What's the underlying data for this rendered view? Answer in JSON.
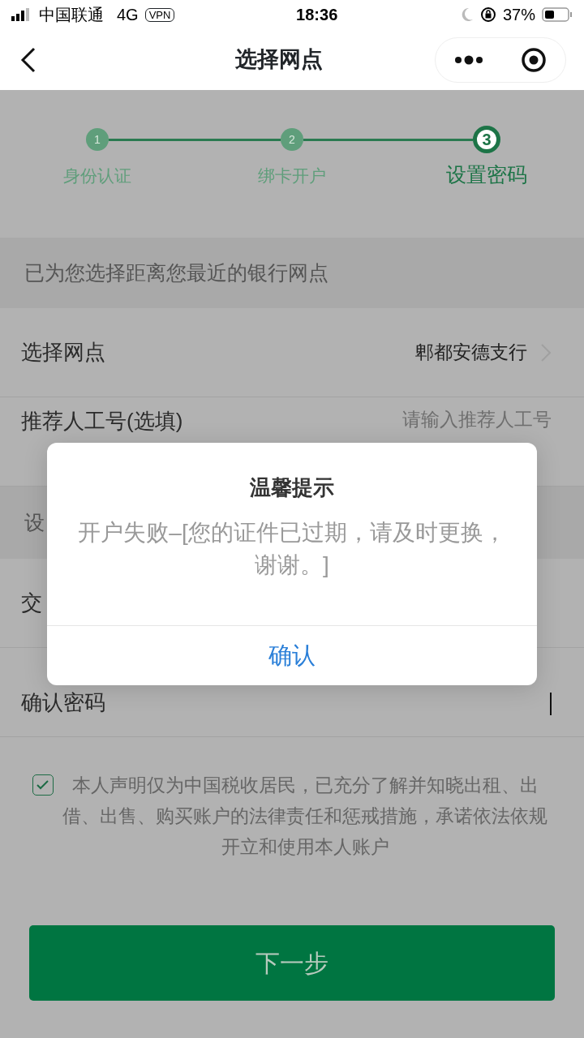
{
  "status_bar": {
    "carrier": "中国联通",
    "network": "4G",
    "vpn": "VPN",
    "time": "18:36",
    "battery": "37%"
  },
  "nav": {
    "title": "选择网点"
  },
  "steps": [
    {
      "number": "1",
      "label": "身份认证",
      "selected": false
    },
    {
      "number": "2",
      "label": "绑卡开户",
      "selected": false
    },
    {
      "number": "3",
      "label": "设置密码",
      "selected": true
    }
  ],
  "form": [
    {
      "kind": "notice",
      "label": "已为您选择距离您最近的银行网点"
    },
    {
      "kind": "select",
      "label": "选择网点",
      "value": "郫都安德支行"
    },
    {
      "kind": "input",
      "label": "推荐人工号(选填)",
      "placeholder": "请输入推荐人工号"
    },
    {
      "kind": "header",
      "label": "设"
    },
    {
      "kind": "field",
      "label": "交"
    },
    {
      "kind": "focused",
      "label": "确认密码"
    }
  ],
  "agreement": {
    "checked": true,
    "text": "本人声明仅为中国税收居民，已充分了解并知晓出租、出借、出售、购买账户的法律责任和惩戒措施，承诺依法依规开立和使用本人账户"
  },
  "next_button": "下一步",
  "dialog": {
    "title": "温馨提示",
    "message": "开户失败–[您的证件已过期，请及时更换，谢谢。]",
    "confirm": "确认"
  }
}
